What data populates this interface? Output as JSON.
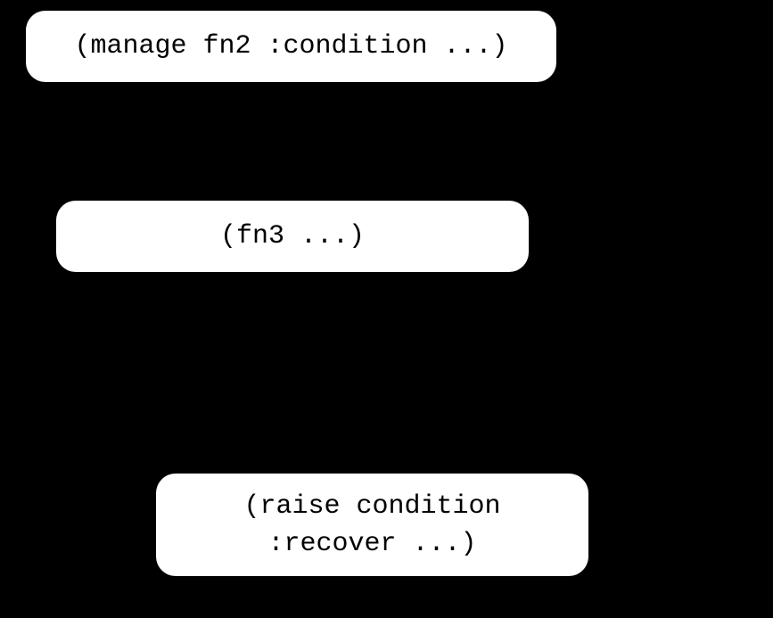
{
  "diagram": {
    "nodes": [
      {
        "id": "node1",
        "label": "(manage fn2 :condition ...)"
      },
      {
        "id": "node2",
        "label": "(fn3 ...)"
      },
      {
        "id": "node3",
        "label": "(raise condition :recover ...)"
      }
    ]
  }
}
